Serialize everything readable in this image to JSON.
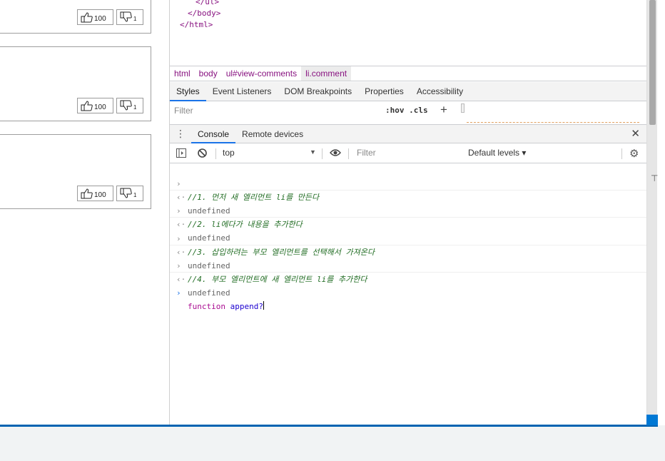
{
  "comments": [
    {
      "likes": "100",
      "dislikes": "1"
    },
    {
      "likes": "100",
      "dislikes": "1"
    },
    {
      "likes": "100",
      "dislikes": "1"
    }
  ],
  "elements_lines": [
    "</ul>",
    "</body>",
    "</html>"
  ],
  "breadcrumbs": [
    "html",
    "body",
    "ul#view-comments",
    "li.comment"
  ],
  "style_tabs": [
    "Styles",
    "Event Listeners",
    "DOM Breakpoints",
    "Properties",
    "Accessibility"
  ],
  "styles_filter_placeholder": "Filter",
  "hov_cls": ":hov  .cls",
  "drawer_tabs": [
    "Console",
    "Remote devices"
  ],
  "console_toolbar": {
    "context": "top",
    "filter_placeholder": "Filter",
    "levels": "Default levels ▾"
  },
  "console_lines": [
    {
      "kind": "input",
      "text": "//1. 먼저 새 엘리먼트 li를 만든다"
    },
    {
      "kind": "output",
      "text": "undefined"
    },
    {
      "kind": "input",
      "text": "//2. li에다가 내용을 추가한다"
    },
    {
      "kind": "output",
      "text": "undefined"
    },
    {
      "kind": "input",
      "text": "//3. 삽입하려는 부모 엘리먼트를 선택해서 가져온다"
    },
    {
      "kind": "output",
      "text": "undefined"
    },
    {
      "kind": "input",
      "text": "//4. 부모 엘리먼트에 새 엘리먼트 li를 추가한다"
    },
    {
      "kind": "output",
      "text": "undefined"
    }
  ],
  "prompt": {
    "keyword": "function",
    "name": "append?"
  },
  "icons": [
    "thumbs-up-icon",
    "thumbs-down-icon",
    "kebab-menu-icon",
    "close-icon",
    "sidebar-toggle-icon",
    "clear-console-icon",
    "eye-icon",
    "gear-icon"
  ],
  "colors": {
    "accent": "#1a73e8",
    "tag": "#881280",
    "comment": "#236e25",
    "keyword": "#aa0d91",
    "taskbar": "#0063b1"
  }
}
